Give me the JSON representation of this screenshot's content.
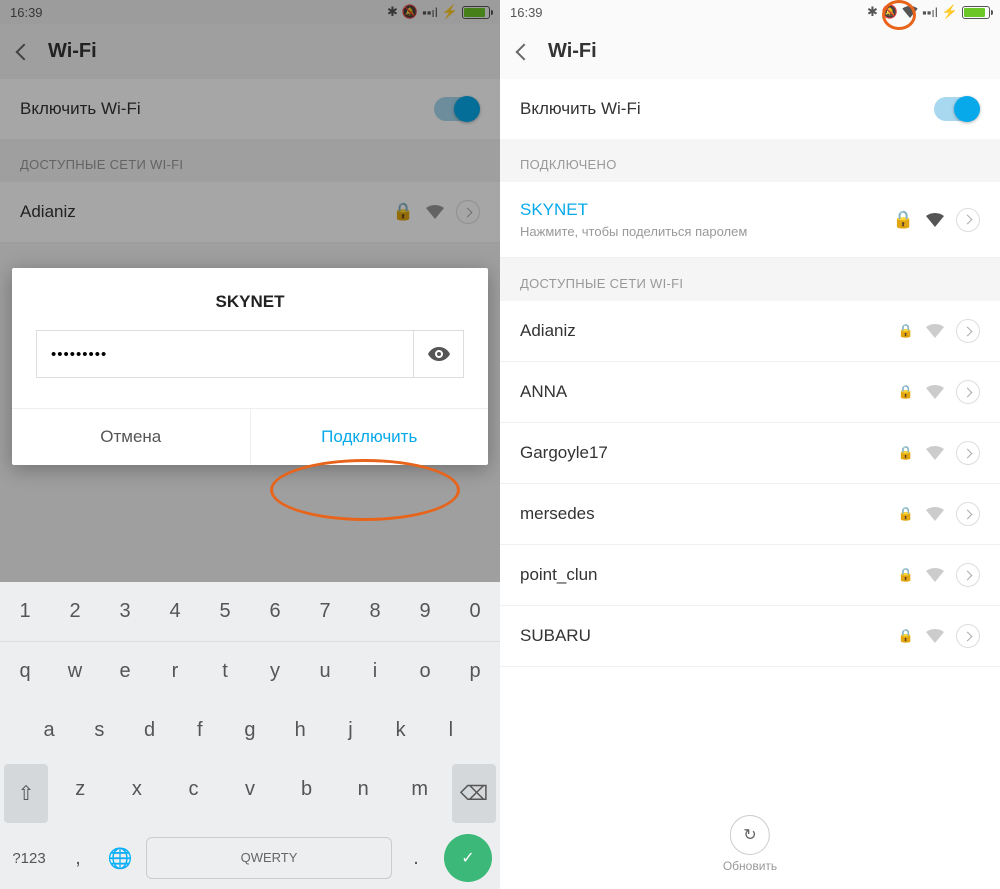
{
  "status": {
    "time": "16:39"
  },
  "header": {
    "title": "Wi-Fi"
  },
  "toggle_label": "Включить Wi-Fi",
  "left": {
    "section": "ДОСТУПНЫЕ СЕТИ WI-FI",
    "visible_network": "Adianiz",
    "dialog": {
      "title": "SKYNET",
      "password": "•••••••••",
      "cancel": "Отмена",
      "connect": "Подключить"
    },
    "keyboard": {
      "nums": [
        "1",
        "2",
        "3",
        "4",
        "5",
        "6",
        "7",
        "8",
        "9",
        "0"
      ],
      "r1": [
        "q",
        "w",
        "e",
        "r",
        "t",
        "y",
        "u",
        "i",
        "o",
        "p"
      ],
      "r2": [
        "a",
        "s",
        "d",
        "f",
        "g",
        "h",
        "j",
        "k",
        "l"
      ],
      "r3": [
        "z",
        "x",
        "c",
        "v",
        "b",
        "n",
        "m"
      ],
      "sym": "?123",
      "space": "QWERTY",
      "comma": ",",
      "period": "."
    }
  },
  "right": {
    "connected_label": "ПОДКЛЮЧЕНО",
    "connected": {
      "name": "SKYNET",
      "hint": "Нажмите, чтобы поделиться паролем"
    },
    "avail_label": "ДОСТУПНЫЕ СЕТИ WI-FI",
    "nets": [
      "Adianiz",
      "ANNA",
      "Gargoyle17",
      "mersedes",
      "point_clun",
      "SUBARU"
    ],
    "refresh": "Обновить"
  }
}
